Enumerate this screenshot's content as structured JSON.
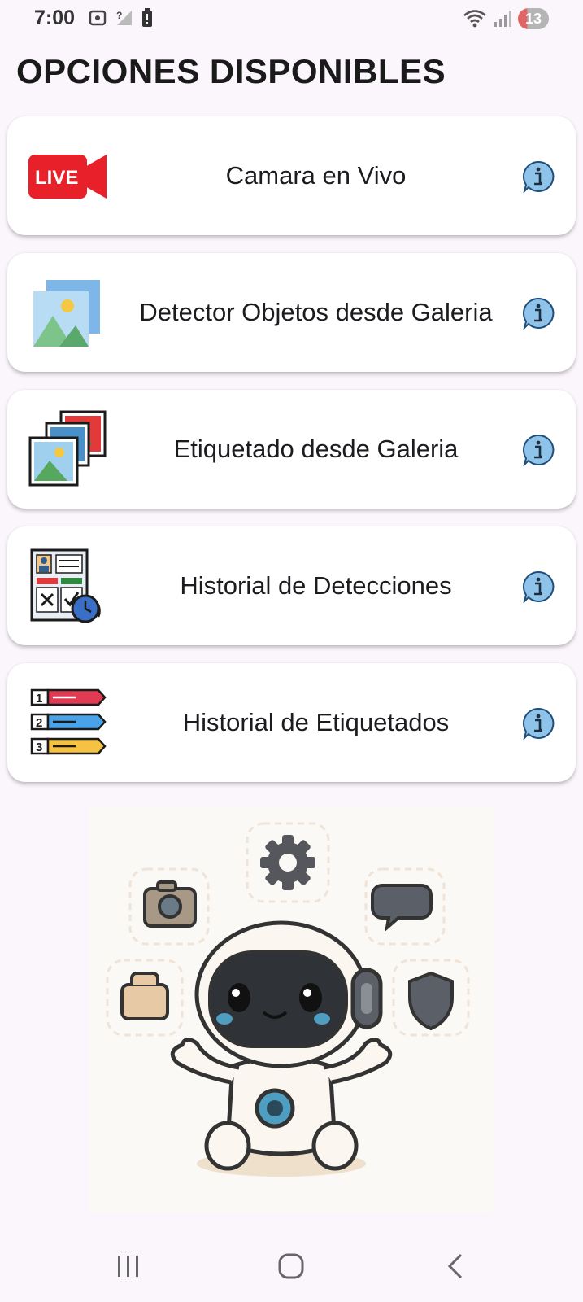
{
  "status_bar": {
    "time": "7:00",
    "battery_level": "13",
    "icons": [
      "screenshot-icon",
      "signal-off-icon",
      "battery-alert-icon",
      "wifi-icon",
      "cell-signal-icon"
    ]
  },
  "page": {
    "title": "OPCIONES DISPONIBLES"
  },
  "options": [
    {
      "label": "Camara en Vivo",
      "icon": "live-camera-icon"
    },
    {
      "label": "Detector Objetos desde Galeria",
      "icon": "gallery-image-icon"
    },
    {
      "label": "Etiquetado desde Galeria",
      "icon": "photo-stack-icon"
    },
    {
      "label": "Historial de Detecciones",
      "icon": "detection-history-icon"
    },
    {
      "label": "Historial de Etiquetados",
      "icon": "ranked-list-icon"
    }
  ],
  "illustration": {
    "name": "robot-mascot",
    "icons": [
      "camera-icon",
      "gear-icon",
      "chat-bubble-icon",
      "folder-icon",
      "shield-icon"
    ]
  },
  "colors": {
    "background": "#fbf5fc",
    "card": "#ffffff",
    "info_blue": "#8fc3ea",
    "live_red": "#e8202a"
  },
  "nav": {
    "buttons": [
      "recent-apps-icon",
      "home-icon",
      "back-icon"
    ]
  }
}
